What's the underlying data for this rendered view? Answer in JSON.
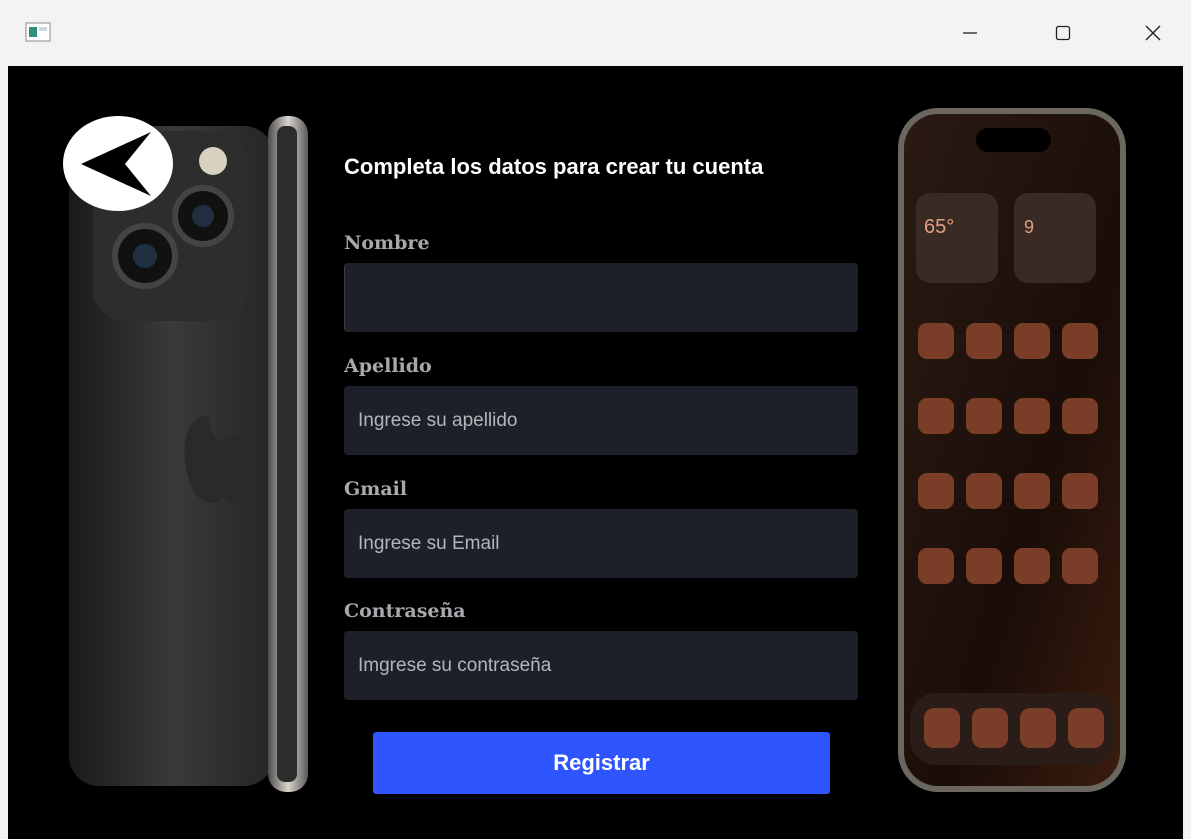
{
  "window": {
    "icon": "app-window-icon",
    "controls": {
      "minimize": "minimize-icon",
      "maximize": "maximize-icon",
      "close": "close-icon"
    }
  },
  "back_button": {
    "icon": "chevron-left-icon"
  },
  "form": {
    "title": "Completa los datos para crear tu cuenta",
    "fields": [
      {
        "label": "Nombre",
        "placeholder": "",
        "value": ""
      },
      {
        "label": "Apellido",
        "placeholder": "Ingrese su apellido",
        "value": ""
      },
      {
        "label": "Gmail",
        "placeholder": "Ingrese su Email",
        "value": ""
      },
      {
        "label": "Contraseña",
        "placeholder": "Imgrese su contraseña",
        "value": ""
      }
    ],
    "submit_label": "Registrar"
  },
  "colors": {
    "background": "#000000",
    "input_bg": "#1d2028",
    "label": "#a7a9ad",
    "accent": "#2f55ff",
    "phone_accent": "#c9663f"
  }
}
